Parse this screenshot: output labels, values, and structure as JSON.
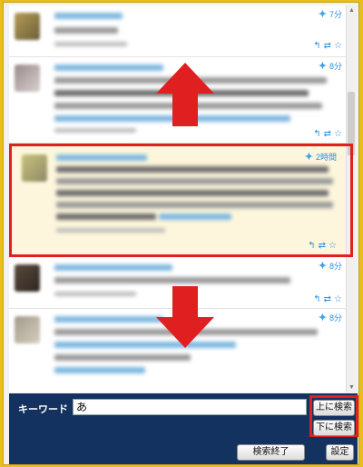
{
  "tweets": [
    {
      "time": "7分"
    },
    {
      "time": "8分"
    },
    {
      "time": "2時間"
    },
    {
      "time": "8分"
    },
    {
      "time": "8分"
    }
  ],
  "actions": {
    "reply": "↰",
    "retweet": "⇄",
    "favorite": "☆"
  },
  "search": {
    "label": "キーワード",
    "value": "あ",
    "search_up": "上に検索",
    "search_down": "下に検索",
    "end_search": "検索終了",
    "settings": "設定"
  },
  "colors": {
    "highlight_border": "#e02020",
    "arrow": "#e02020",
    "footer_bg": "#13325f",
    "link": "#2a8fe0"
  }
}
